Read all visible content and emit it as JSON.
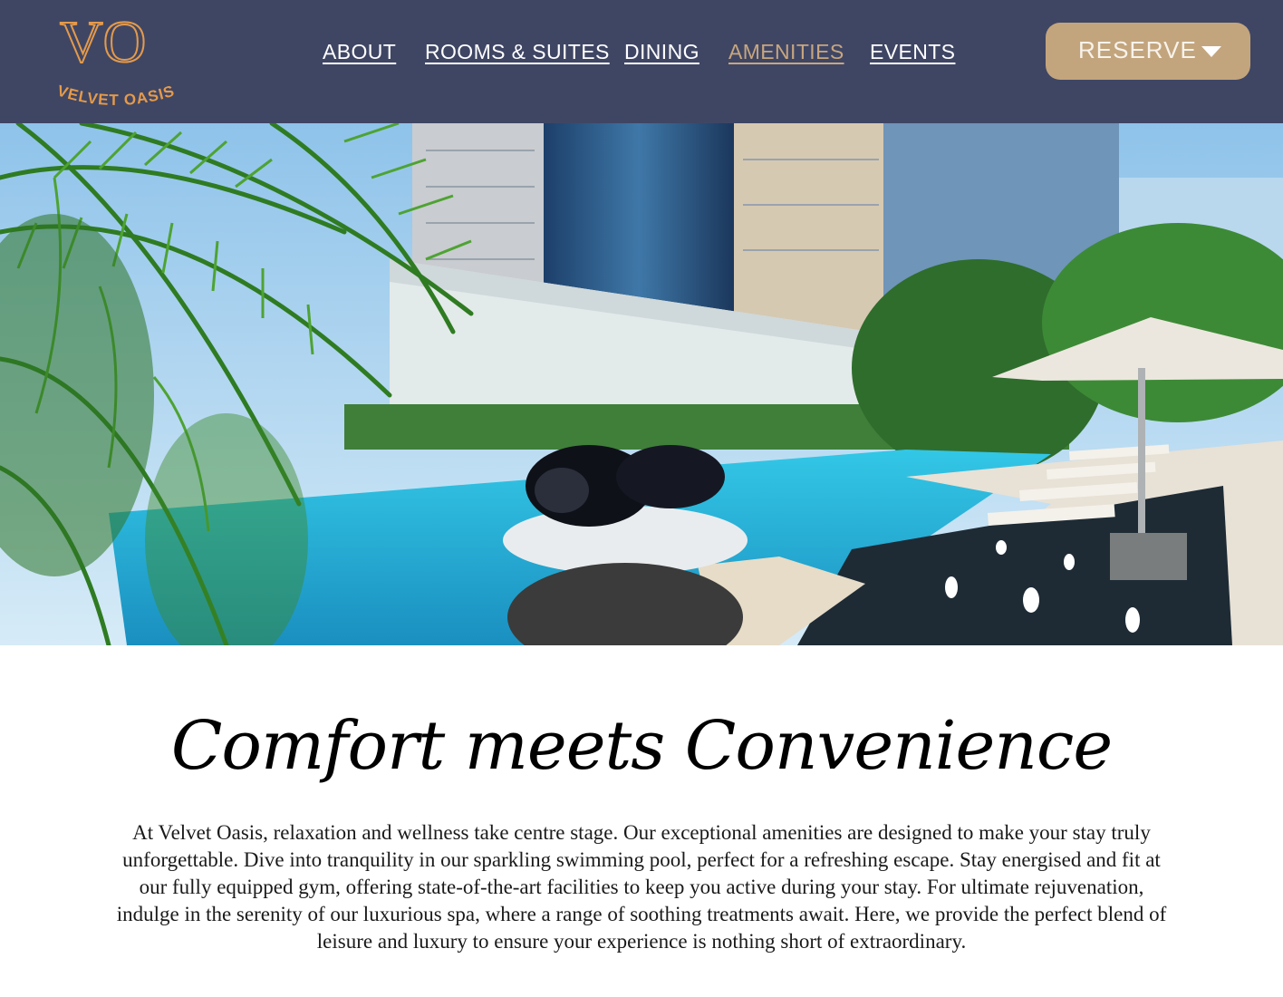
{
  "brand": {
    "monogram": "VO",
    "name": "VELVET OASIS",
    "color": "#e59a4a"
  },
  "nav": {
    "items": [
      {
        "label": "ABOUT"
      },
      {
        "label": "ROOMS & SUITES"
      },
      {
        "label": "DINING"
      },
      {
        "label": "AMENITIES",
        "active": true
      },
      {
        "label": "EVENTS"
      }
    ],
    "reserve_label": "RESERVE",
    "reserve_icon": "chevron-down-icon"
  },
  "colors": {
    "header_bg": "#3f4664",
    "accent_gold": "#c3a57d",
    "active_nav": "#c8a67e"
  },
  "hero": {
    "subject": "rooftop-pool-photo"
  },
  "content": {
    "title": "Comfort meets Convenience",
    "description": "At Velvet Oasis, relaxation and wellness take centre stage. Our exceptional amenities are designed to make your stay truly unforgettable. Dive into tranquility in our sparkling swimming pool, perfect for a refreshing escape. Stay energised and fit at our fully equipped gym, offering state-of-the-art facilities to keep you active during your stay. For ultimate rejuvenation, indulge in the serenity of our luxurious spa, where a range of soothing treatments await. Here, we provide the perfect blend of leisure and luxury to ensure your experience is nothing short of extraordinary."
  }
}
